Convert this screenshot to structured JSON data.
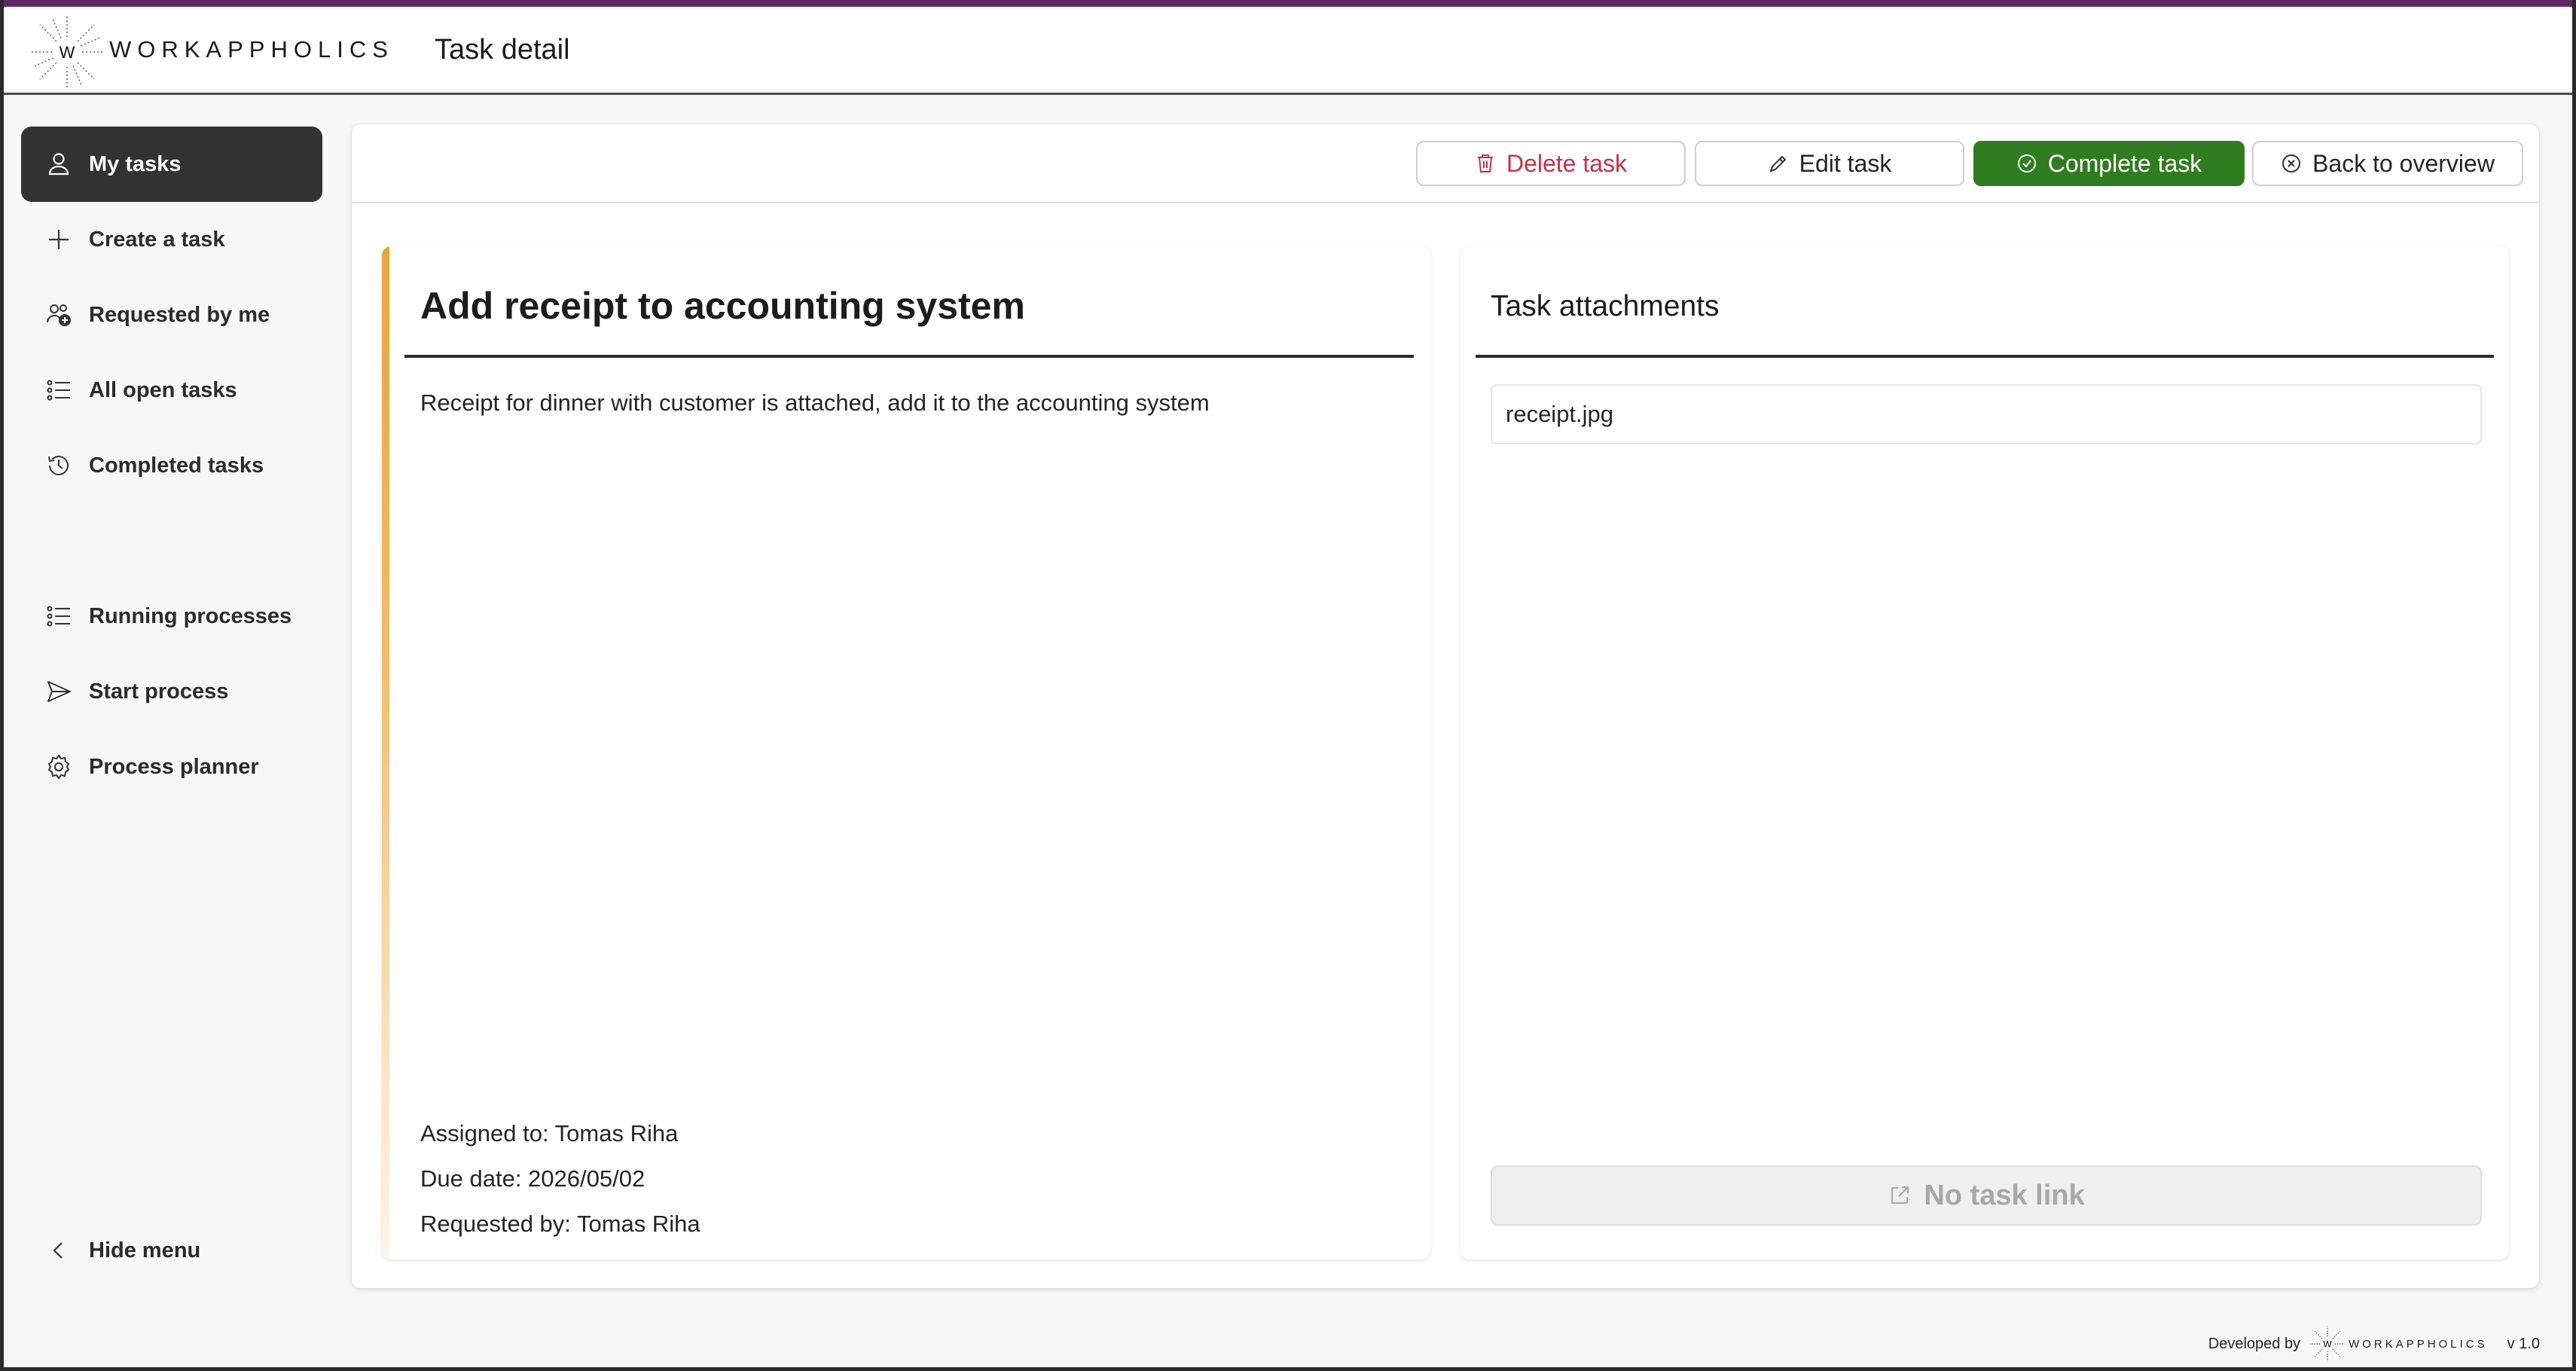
{
  "header": {
    "brand": "WORKAPPHOLICS",
    "logo_letter": "W",
    "page_title": "Task detail"
  },
  "sidebar": {
    "items": [
      {
        "label": "My tasks",
        "icon": "person-icon",
        "active": true
      },
      {
        "label": "Create a task",
        "icon": "plus-icon"
      },
      {
        "label": "Requested by me",
        "icon": "people-add-icon"
      },
      {
        "label": "All open tasks",
        "icon": "list-icon"
      },
      {
        "label": "Completed tasks",
        "icon": "history-icon"
      },
      {
        "label": "Running processes",
        "icon": "list-icon"
      },
      {
        "label": "Start process",
        "icon": "send-icon"
      },
      {
        "label": "Process planner",
        "icon": "gear-icon"
      }
    ],
    "hide_menu": "Hide menu"
  },
  "toolbar": {
    "delete_label": "Delete task",
    "edit_label": "Edit task",
    "complete_label": "Complete task",
    "back_label": "Back to overview"
  },
  "task": {
    "title": "Add receipt to accounting system",
    "description": "Receipt for dinner with customer is attached, add it to the accounting system",
    "assigned_to": "Assigned to: Tomas Riha",
    "due_date": "Due date: 2026/05/02",
    "requested_by": "Requested by: Tomas Riha"
  },
  "attachments": {
    "title": "Task attachments",
    "items": [
      "receipt.jpg"
    ],
    "no_link_label": "No task link"
  },
  "footer": {
    "developed_by": "Developed by",
    "brand": "WORKAPPHOLICS",
    "version": "v 1.0"
  },
  "colors": {
    "accent_purple": "#5f2a63",
    "complete_green": "#2f7d20",
    "delete_red": "#c4314b",
    "task_accent_orange": "#e8a53c",
    "active_nav": "#323232"
  }
}
